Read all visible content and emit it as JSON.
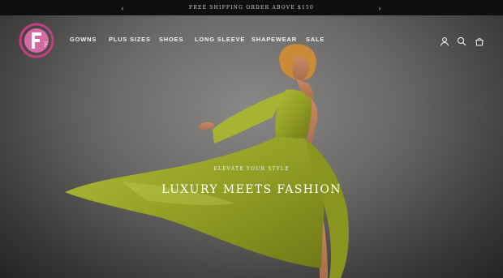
{
  "announcement": {
    "text": "Free shipping order above $150",
    "prev_label": "‹",
    "next_label": "›"
  },
  "brand": {
    "logo_text": "F"
  },
  "nav": {
    "items": [
      "Gowns",
      "Plus sizes",
      "Shoes",
      "Long sleeve",
      "Shapewear",
      "Sale"
    ]
  },
  "header_icons": [
    "account-icon",
    "search-icon",
    "cart-icon"
  ],
  "hero": {
    "eyebrow": "Elevate your style",
    "headline": "Luxury meets fashion"
  },
  "colors": {
    "dress": "#9aa52a",
    "logo_pink": "#c2407f",
    "bg": "#6b6a68"
  }
}
